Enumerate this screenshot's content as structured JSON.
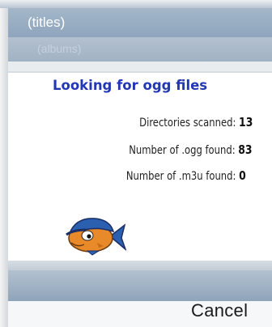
{
  "header": {
    "title": "(titles)",
    "subtitle": "(albums)"
  },
  "dialog": {
    "title": "Looking for ogg files",
    "rows": [
      {
        "label": "Directories scanned:",
        "value": "13"
      },
      {
        "label": "Number of .ogg found:",
        "value": "83"
      },
      {
        "label": "Number of .m3u found:",
        "value": "0"
      }
    ],
    "mascot_icon": "fish-mascot-icon"
  },
  "softkeys": {
    "right_label": "Cancel"
  },
  "colors": {
    "title_blue": "#2337b5",
    "header_bar": "#9aafc4",
    "mascot_orange": "#e98a2a",
    "mascot_blue": "#2b5fb0"
  }
}
